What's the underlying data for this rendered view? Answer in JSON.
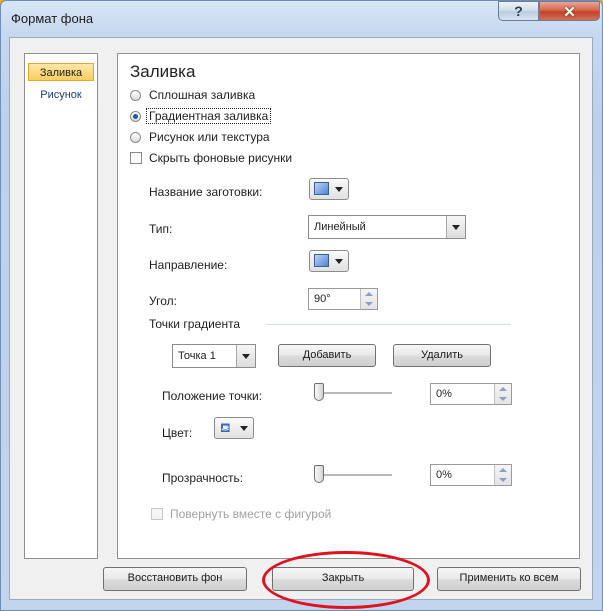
{
  "window": {
    "title": "Формат фона",
    "help_glyph": "?",
    "close_glyph": "✕"
  },
  "nav": {
    "items": [
      {
        "label": "Заливка",
        "active": true
      },
      {
        "label": "Рисунок",
        "active": false
      }
    ]
  },
  "panel": {
    "heading": "Заливка",
    "options": {
      "solid": "Сплошная заливка",
      "gradient": "Градиентная заливка",
      "picture": "Рисунок или текстура",
      "hide_bg": "Скрыть фоновые рисунки"
    },
    "selected_option": "gradient",
    "preset_label": "Название заготовки:",
    "type_label": "Тип:",
    "type_value": "Линейный",
    "direction_label": "Направление:",
    "angle_label": "Угол:",
    "angle_value": "90°",
    "stops_label": "Точки градиента",
    "stop_select_value": "Точка 1",
    "add_button": "Добавить",
    "remove_button": "Удалить",
    "position_label": "Положение точки:",
    "position_value": "0%",
    "position_slider": 0,
    "color_label": "Цвет:",
    "transparency_label": "Прозрачность:",
    "transparency_value": "0%",
    "transparency_slider": 0,
    "rotate_label": "Повернуть вместе с фигурой"
  },
  "footer": {
    "reset_button": "Восстановить фон",
    "close_button": "Закрыть",
    "apply_all_button": "Применить ко всем"
  },
  "colors": {
    "accent_highlight": "#f9cf62",
    "annotation": "#e0121d",
    "swatch": "#4f86d4"
  }
}
